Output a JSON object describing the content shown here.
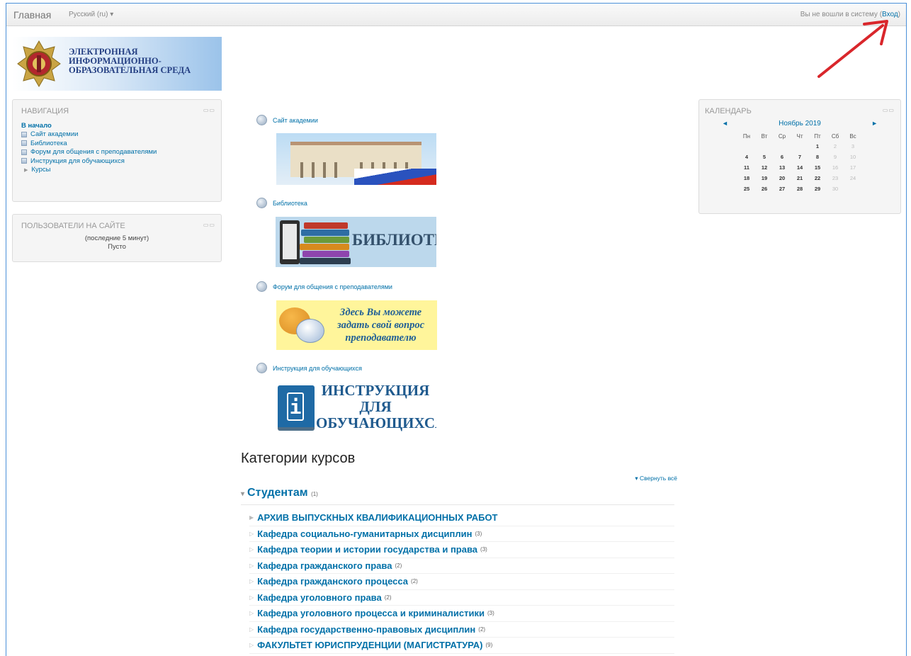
{
  "navbar": {
    "home": "Главная",
    "language": "Русский (ru) ▾",
    "login_text": "Вы не вошли в систему (",
    "login_link": "Вход",
    "login_close": ")"
  },
  "logo": {
    "line1": "Электронная",
    "line2": "информационно-",
    "line3": "образовательная среда"
  },
  "navigation": {
    "title": "Навигация",
    "items": [
      {
        "label": "В начало"
      },
      {
        "label": "Сайт академии"
      },
      {
        "label": "Библиотека"
      },
      {
        "label": "Форум для общения с преподавателями"
      },
      {
        "label": "Инструкция для обучающихся"
      },
      {
        "label": "Курсы"
      }
    ]
  },
  "users_online": {
    "title": "Пользователи на сайте",
    "period": "(последние 5 минут)",
    "status": "Пусто"
  },
  "calendar": {
    "title": "Календарь",
    "prev": "◄",
    "next": "►",
    "month": "Ноябрь 2019",
    "weekdays": [
      "Пн",
      "Вт",
      "Ср",
      "Чт",
      "Пт",
      "Сб",
      "Вс"
    ],
    "weeks": [
      [
        "",
        "",
        "",
        "",
        "1",
        "2",
        "3"
      ],
      [
        "4",
        "5",
        "6",
        "7",
        "8",
        "9",
        "10"
      ],
      [
        "11",
        "12",
        "13",
        "14",
        "15",
        "16",
        "17"
      ],
      [
        "18",
        "19",
        "20",
        "21",
        "22",
        "23",
        "24"
      ],
      [
        "25",
        "26",
        "27",
        "28",
        "29",
        "30",
        ""
      ]
    ]
  },
  "main_links": [
    {
      "label": "Сайт академии"
    },
    {
      "label": "Библиотека",
      "banner": "БИБЛИОТЕКА"
    },
    {
      "label": "Форум для общения с преподавателями",
      "banner_l1": "Здесь Вы можете",
      "banner_l2": "задать свой вопрос",
      "banner_l3": "преподавателю"
    },
    {
      "label": "Инструкция для обучающихся",
      "banner_l1": "ИНСТРУКЦИЯ",
      "banner_l2": "ДЛЯ",
      "banner_l3": "ОБУЧАЮЩИХСЯ"
    }
  ],
  "categories": {
    "heading": "Категории курсов",
    "collapse_all": "▾ Свернуть всё",
    "top": {
      "name": "Студентам",
      "count": "(1)"
    },
    "items": [
      {
        "name": "АРХИВ ВЫПУСКНЫХ КВАЛИФИКАЦИОННЫХ РАБОТ",
        "count": ""
      },
      {
        "name": "Кафедра социально-гуманитарных дисциплин",
        "count": "(3)"
      },
      {
        "name": "Кафедра теории и истории государства и права",
        "count": "(3)"
      },
      {
        "name": "Кафедра гражданского права",
        "count": "(2)"
      },
      {
        "name": "Кафедра гражданского процесса",
        "count": "(2)"
      },
      {
        "name": "Кафедра уголовного права",
        "count": "(2)"
      },
      {
        "name": "Кафедра уголовного процесса и криминалистики",
        "count": "(3)"
      },
      {
        "name": "Кафедра государственно-правовых дисциплин",
        "count": "(2)"
      },
      {
        "name": "ФАКУЛЬТЕТ ЮРИСПРУДЕНЦИИ (МАГИСТРАТУРА)",
        "count": "(9)"
      }
    ]
  },
  "colors": {
    "link": "#0070a8",
    "annotation_arrow": "#d9262b"
  }
}
